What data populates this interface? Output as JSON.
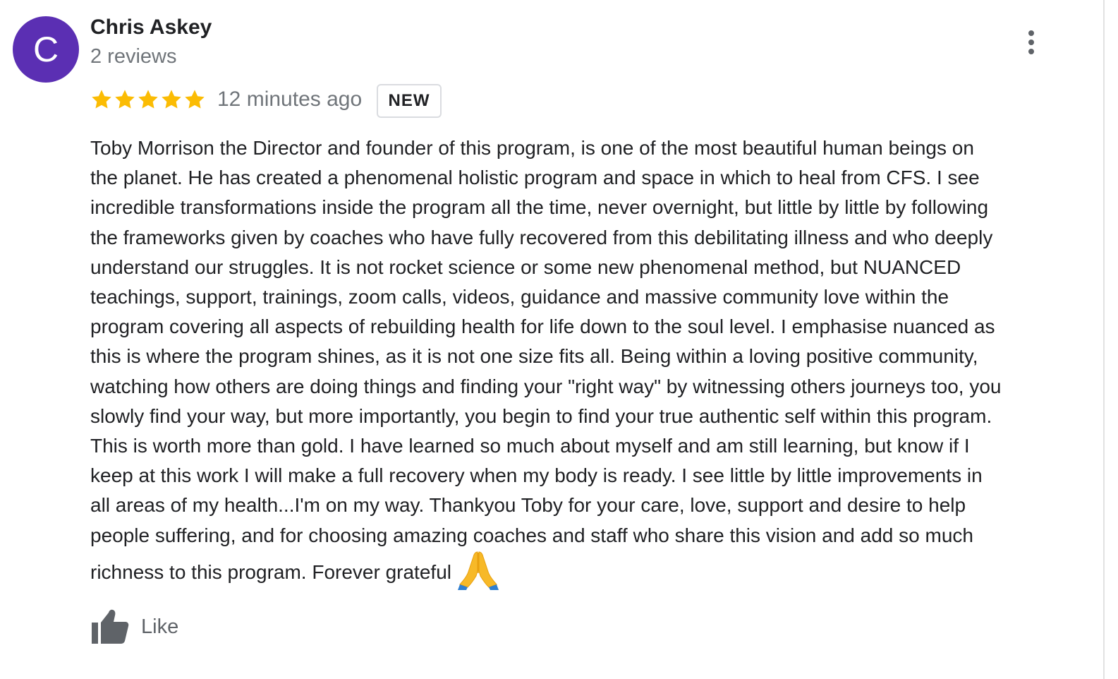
{
  "author": {
    "initial": "C",
    "name": "Chris Askey",
    "review_count": "2 reviews",
    "avatar_color": "#5b2fb3"
  },
  "menu": {
    "icon": "more-vertical-icon"
  },
  "rating": {
    "stars": 5,
    "max_stars": 5,
    "star_color": "#fbbc04",
    "icon": "star-icon"
  },
  "time_ago": "12 minutes ago",
  "badge": "NEW",
  "review_lines": [
    "Toby Morrison the Director and founder of this program, is one of the most beautiful human beings on",
    "the planet. He has created a phenomenal holistic program and space in which to heal from CFS. I see",
    "incredible transformations inside the program all the time, never overnight, but little by little by following",
    "the frameworks given by coaches who have fully recovered from this debilitating illness and who deeply",
    "understand our struggles. It is not rocket science or some new phenomenal method, but NUANCED",
    "teachings, support, trainings, zoom calls, videos, guidance and massive community love within the",
    "program covering all aspects of rebuilding health for life down to the soul level. I emphasise nuanced as",
    "this is where the program shines, as it is not one size fits all. Being within a loving positive community,",
    "watching how others are doing things and finding your \"right way\" by witnessing others journeys too, you",
    "slowly find your way, but more importantly, you begin to find your true authentic self within this program.",
    "This is worth more than gold. I have learned so much about myself and am still learning, but know if I",
    "keep at this work I will make a full recovery when my body is ready. I see little by little improvements in",
    "all areas of my health...I'm on my way. Thankyou Toby for your care, love, support and desire to help",
    "people suffering, and for choosing amazing coaches and staff who share this vision and add so much",
    "richness to this program. Forever grateful"
  ],
  "review_emoji": "folded-hands-icon",
  "actions": {
    "like_label": "Like",
    "like_icon": "thumbs-up-icon"
  }
}
